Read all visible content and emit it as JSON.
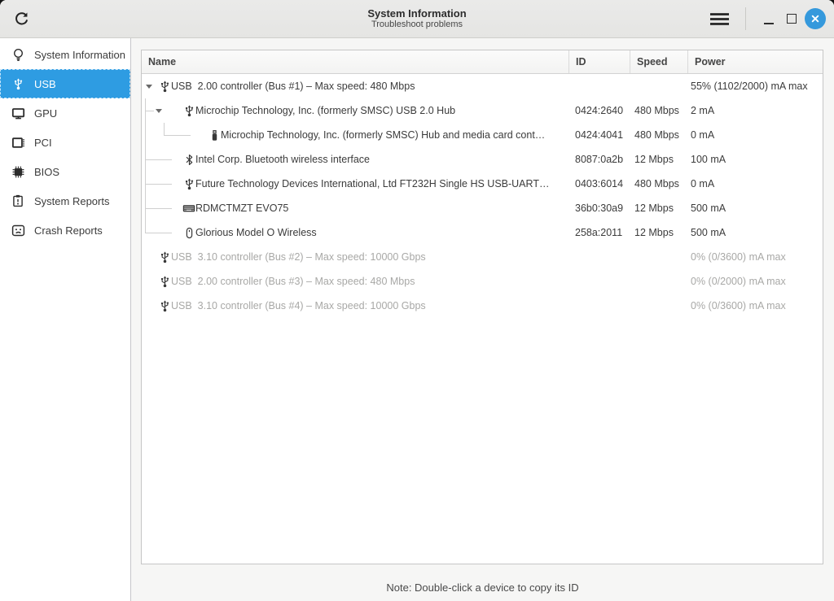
{
  "window": {
    "title": "System Information",
    "subtitle": "Troubleshoot problems",
    "header_icons": [
      "refresh-icon",
      "hamburger-icon",
      "minimize-icon",
      "maximize-icon",
      "close-icon"
    ]
  },
  "colors": {
    "accent": "#2e9ce2",
    "close_button": "#3599dc",
    "headerbar_bg": "#e7e7e6",
    "dim_text": "#a8a8a6"
  },
  "sidebar": {
    "items": [
      {
        "label": "System Information",
        "icon": "lightbulb-icon",
        "selected": false
      },
      {
        "label": "USB",
        "icon": "usb-icon",
        "selected": true
      },
      {
        "label": "GPU",
        "icon": "monitor-icon",
        "selected": false
      },
      {
        "label": "PCI",
        "icon": "pci-card-icon",
        "selected": false
      },
      {
        "label": "BIOS",
        "icon": "chip-icon",
        "selected": false
      },
      {
        "label": "System Reports",
        "icon": "clipboard-icon",
        "selected": false
      },
      {
        "label": "Crash Reports",
        "icon": "crash-face-icon",
        "selected": false
      }
    ]
  },
  "table": {
    "columns": [
      "Name",
      "ID",
      "Speed",
      "Power"
    ],
    "rows": [
      {
        "name": "USB  2.00 controller (Bus #1) – Max speed: 480 Mbps",
        "id": "",
        "speed": "",
        "power": "55% (1102/2000) mA max",
        "level": 0,
        "expander": true,
        "icon": "usb-icon",
        "dim": false
      },
      {
        "name": "Microchip Technology, Inc. (formerly SMSC) USB 2.0 Hub",
        "id": "0424:2640",
        "speed": "480 Mbps",
        "power": "2 mA",
        "level": 1,
        "expander": true,
        "icon": "usb-icon",
        "dim": false
      },
      {
        "name": "Microchip Technology, Inc. (formerly SMSC) Hub and media card cont…",
        "id": "0424:4041",
        "speed": "480 Mbps",
        "power": "0 mA",
        "level": 2,
        "expander": false,
        "icon": "flash-drive-icon",
        "dim": false
      },
      {
        "name": "Intel Corp. Bluetooth wireless interface",
        "id": "8087:0a2b",
        "speed": "12 Mbps",
        "power": "100 mA",
        "level": 1,
        "expander": false,
        "icon": "bluetooth-icon",
        "dim": false
      },
      {
        "name": "Future Technology Devices International, Ltd FT232H Single HS USB-UART…",
        "id": "0403:6014",
        "speed": "480 Mbps",
        "power": "0 mA",
        "level": 1,
        "expander": false,
        "icon": "usb-icon",
        "dim": false
      },
      {
        "name": "RDMCTMZT EVO75",
        "id": "36b0:30a9",
        "speed": "12 Mbps",
        "power": "500 mA",
        "level": 1,
        "expander": false,
        "icon": "keyboard-icon",
        "dim": false
      },
      {
        "name": "Glorious Model O Wireless",
        "id": "258a:2011",
        "speed": "12 Mbps",
        "power": "500 mA",
        "level": 1,
        "expander": false,
        "icon": "mouse-icon",
        "dim": false
      },
      {
        "name": "USB  3.10 controller (Bus #2) – Max speed: 10000 Gbps",
        "id": "",
        "speed": "",
        "power": "0% (0/3600) mA max",
        "level": 0,
        "expander": false,
        "icon": "usb-icon",
        "dim": true
      },
      {
        "name": "USB  2.00 controller (Bus #3) – Max speed: 480 Mbps",
        "id": "",
        "speed": "",
        "power": "0% (0/2000) mA max",
        "level": 0,
        "expander": false,
        "icon": "usb-icon",
        "dim": true
      },
      {
        "name": "USB  3.10 controller (Bus #4) – Max speed: 10000 Gbps",
        "id": "",
        "speed": "",
        "power": "0% (0/3600) mA max",
        "level": 0,
        "expander": false,
        "icon": "usb-icon",
        "dim": true
      }
    ]
  },
  "footer": {
    "note": "Note: Double-click a device to copy its ID"
  }
}
